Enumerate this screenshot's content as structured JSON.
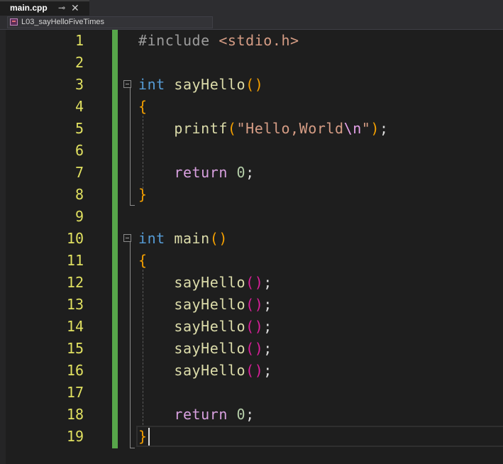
{
  "tab": {
    "title": "main.cpp",
    "pin": "⊸",
    "close": "✕"
  },
  "nav": {
    "project": "L03_sayHelloFiveTimes"
  },
  "lines": [
    {
      "n": "1",
      "tokens": [
        [
          "k-pre",
          "#include "
        ],
        [
          "k-hdr",
          "<stdio.h>"
        ]
      ]
    },
    {
      "n": "2",
      "tokens": []
    },
    {
      "n": "3",
      "tokens": [
        [
          "k-type",
          "int "
        ],
        [
          "k-fn",
          "sayHello"
        ],
        [
          "k-par",
          "()"
        ]
      ]
    },
    {
      "n": "4",
      "tokens": [
        [
          "k-par",
          "{"
        ]
      ]
    },
    {
      "n": "5",
      "tokens": [
        [
          "k-txt",
          "    "
        ],
        [
          "k-fn",
          "printf"
        ],
        [
          "k-par",
          "("
        ],
        [
          "k-str",
          "\"Hello,World"
        ],
        [
          "k-esc",
          "\\n"
        ],
        [
          "k-str",
          "\""
        ],
        [
          "k-par",
          ")"
        ],
        [
          "k-txt",
          ";"
        ]
      ]
    },
    {
      "n": "6",
      "tokens": []
    },
    {
      "n": "7",
      "tokens": [
        [
          "k-txt",
          "    "
        ],
        [
          "k-kw",
          "return "
        ],
        [
          "k-num",
          "0"
        ],
        [
          "k-txt",
          ";"
        ]
      ]
    },
    {
      "n": "8",
      "tokens": [
        [
          "k-par",
          "}"
        ]
      ]
    },
    {
      "n": "9",
      "tokens": []
    },
    {
      "n": "10",
      "tokens": [
        [
          "k-type",
          "int "
        ],
        [
          "k-fn",
          "main"
        ],
        [
          "k-par",
          "()"
        ]
      ]
    },
    {
      "n": "11",
      "tokens": [
        [
          "k-par",
          "{"
        ]
      ]
    },
    {
      "n": "12",
      "tokens": [
        [
          "k-txt",
          "    "
        ],
        [
          "k-fn",
          "sayHello"
        ],
        [
          "k-par2",
          "()"
        ],
        [
          "k-txt",
          ";"
        ]
      ]
    },
    {
      "n": "13",
      "tokens": [
        [
          "k-txt",
          "    "
        ],
        [
          "k-fn",
          "sayHello"
        ],
        [
          "k-par2",
          "()"
        ],
        [
          "k-txt",
          ";"
        ]
      ]
    },
    {
      "n": "14",
      "tokens": [
        [
          "k-txt",
          "    "
        ],
        [
          "k-fn",
          "sayHello"
        ],
        [
          "k-par2",
          "()"
        ],
        [
          "k-txt",
          ";"
        ]
      ]
    },
    {
      "n": "15",
      "tokens": [
        [
          "k-txt",
          "    "
        ],
        [
          "k-fn",
          "sayHello"
        ],
        [
          "k-par2",
          "()"
        ],
        [
          "k-txt",
          ";"
        ]
      ]
    },
    {
      "n": "16",
      "tokens": [
        [
          "k-txt",
          "    "
        ],
        [
          "k-fn",
          "sayHello"
        ],
        [
          "k-par2",
          "()"
        ],
        [
          "k-txt",
          ";"
        ]
      ]
    },
    {
      "n": "17",
      "tokens": []
    },
    {
      "n": "18",
      "tokens": [
        [
          "k-txt",
          "    "
        ],
        [
          "k-kw",
          "return "
        ],
        [
          "k-num",
          "0"
        ],
        [
          "k-txt",
          ";"
        ]
      ]
    },
    {
      "n": "19",
      "tokens": [
        [
          "k-par",
          "}"
        ]
      ]
    }
  ]
}
